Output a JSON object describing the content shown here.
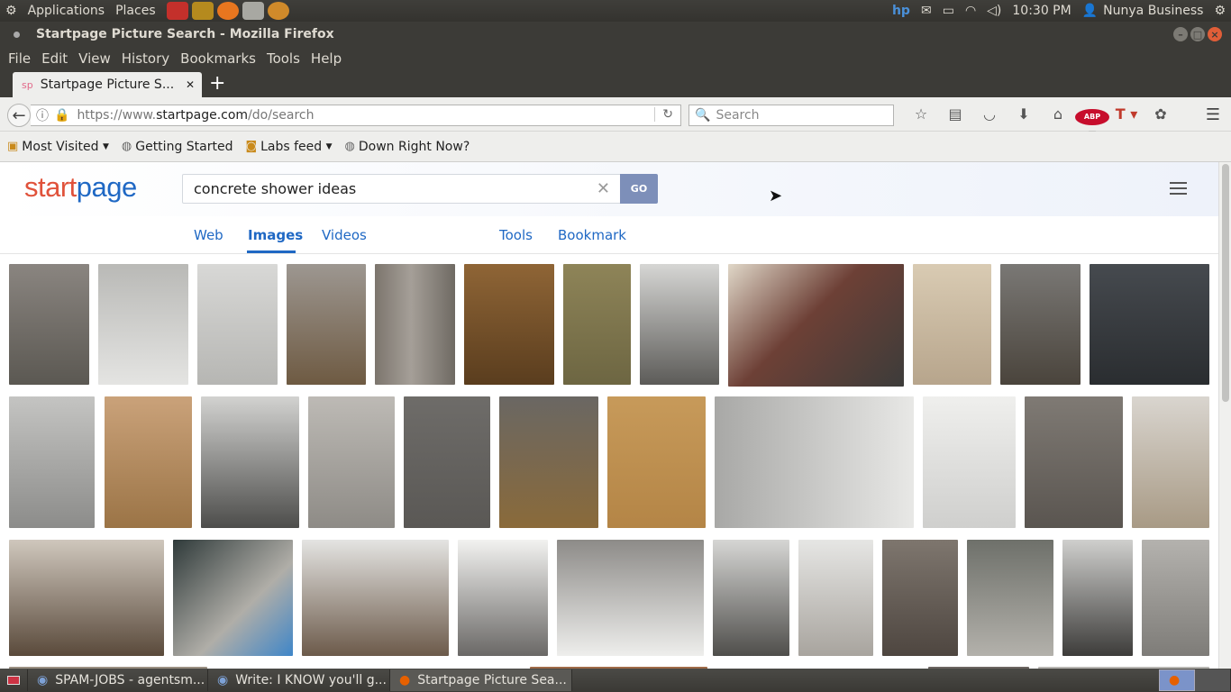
{
  "system": {
    "applications": "Applications",
    "places": "Places",
    "clock": "10:30 PM",
    "user": "Nunya Business"
  },
  "window": {
    "title": "Startpage Picture Search - Mozilla Firefox"
  },
  "menu": [
    "File",
    "Edit",
    "View",
    "History",
    "Bookmarks",
    "Tools",
    "Help"
  ],
  "tab": {
    "favicon": "sp",
    "title": "Startpage Picture S..."
  },
  "nav": {
    "url_prefix": "https://www.",
    "url_host": "startpage.com",
    "url_path": "/do/search",
    "search_placeholder": "Search"
  },
  "bookmarks": [
    {
      "label": "Most Visited",
      "icon": "folder-icon",
      "dropdown": true
    },
    {
      "label": "Getting Started",
      "icon": "globe-icon",
      "dropdown": false
    },
    {
      "label": "Labs feed",
      "icon": "rss-icon",
      "dropdown": true
    },
    {
      "label": "Down Right Now?",
      "icon": "globe-icon",
      "dropdown": false
    }
  ],
  "page": {
    "logo_part1": "start",
    "logo_part2": "page",
    "query": "concrete shower ideas",
    "go": "GO",
    "tabs": {
      "web": "Web",
      "images": "Images",
      "videos": "Videos",
      "tools": "Tools",
      "bookmark": "Bookmark"
    },
    "accent": "#1f68c4"
  },
  "taskbar": [
    {
      "label": "SPAM-JOBS - agentsm...",
      "icon": "thunderbird-icon"
    },
    {
      "label": "Write: I KNOW you'll g...",
      "icon": "thunderbird-icon"
    },
    {
      "label": "Startpage Picture Sea...",
      "icon": "firefox-icon"
    }
  ]
}
